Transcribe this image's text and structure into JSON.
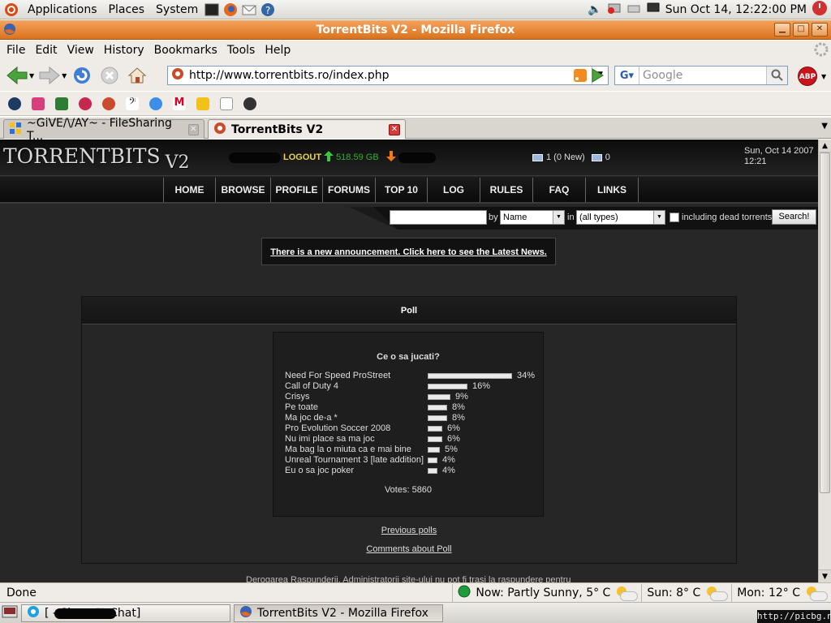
{
  "gnome_panel": {
    "menus": [
      "Applications",
      "Places",
      "System"
    ],
    "clock": "Sun Oct 14, 12:22:00 PM"
  },
  "window": {
    "title": "TorrentBits V2 - Mozilla Firefox"
  },
  "menubar": {
    "items": [
      "File",
      "Edit",
      "View",
      "History",
      "Bookmarks",
      "Tools",
      "Help"
    ]
  },
  "navbar": {
    "url": "http://www.torrentbits.ro/index.php",
    "search_placeholder": "Google"
  },
  "tabs": [
    {
      "label": "~GiVE/\\/AY~ - FileSharing T..."
    },
    {
      "label": "TorrentBits V2"
    }
  ],
  "site": {
    "logo": "TORRENTBITS",
    "logo_version": "V2",
    "logout": "LOGOUT",
    "upload": "518.59 GB",
    "messages": "1 (0 New)",
    "messages_sent": "0",
    "date_line1": "Sun, Oct 14 2007",
    "date_line2": "12:21",
    "nav": [
      "HOME",
      "BROWSE",
      "PROFILE",
      "FORUMS",
      "TOP 10",
      "LOG",
      "RULES",
      "FAQ",
      "LINKS"
    ],
    "search": {
      "by_label": "by",
      "by_value": "Name",
      "in_label": "in",
      "type_value": "(all types)",
      "dead_label": "including dead torrents",
      "button": "Search!"
    },
    "announcement": "There is a new announcement. Click here to see the Latest News.",
    "disclaimer": "Derogarea Raspunderii. Administratorii site-ului nu pot fi trasi la raspundere pentru"
  },
  "poll": {
    "header": "Poll",
    "question": "Ce o sa jucati?",
    "options": [
      {
        "label": "Need For Speed ProStreet",
        "percent": 34,
        "percent_text": "34%"
      },
      {
        "label": "Call of Duty 4",
        "percent": 16,
        "percent_text": "16%"
      },
      {
        "label": "Crisys",
        "percent": 9,
        "percent_text": "9%"
      },
      {
        "label": "Pe toate",
        "percent": 8,
        "percent_text": "8%"
      },
      {
        "label": "Ma joc de-a  *",
        "percent": 8,
        "percent_text": "8%"
      },
      {
        "label": "Pro Evolution Soccer 2008",
        "percent": 6,
        "percent_text": "6%"
      },
      {
        "label": "Nu imi place sa ma joc",
        "percent": 6,
        "percent_text": "6%"
      },
      {
        "label": "Ma bag la o miuta ca e mai bine",
        "percent": 5,
        "percent_text": "5%"
      },
      {
        "label": "Unreal Tournament 3 [late addition]",
        "percent": 4,
        "percent_text": "4%"
      },
      {
        "label": "Eu o sa joc poker",
        "percent": 4,
        "percent_text": "4%"
      }
    ],
    "votes": "Votes: 5860",
    "previous_polls": "Previous polls",
    "comments": "Comments about Poll"
  },
  "statusbar": {
    "status": "Done",
    "weather_now": "Now: Partly Sunny, 5° C",
    "weather_sun": "Sun: 8° C",
    "weather_mon": "Mon: 12° C"
  },
  "taskbar": {
    "skype": "[               - Skype™ Chat]",
    "firefox": "TorrentBits V2 - Mozilla Firefox"
  },
  "watermark": "http://picbg.net/",
  "colors": {
    "firefox_title": "#e07f2a",
    "site_bg": "#272727",
    "logout": "#e8d44c",
    "upload": "#2fae2f"
  }
}
